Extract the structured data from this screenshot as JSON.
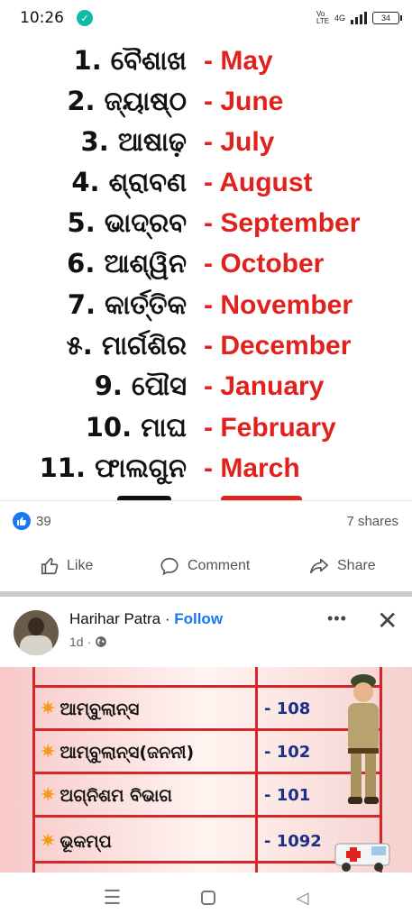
{
  "status_bar": {
    "time": "10:26",
    "network_label": "Vo LTE",
    "network_type": "4G",
    "battery": "34"
  },
  "post1": {
    "image": {
      "months": [
        {
          "odia": "1. ବୈଶାଖ",
          "english": "- May"
        },
        {
          "odia": "2. ଜ୍ୟାଷ୍ଠ",
          "english": "- June"
        },
        {
          "odia": "3. ଆଷାଢ଼",
          "english": "- July"
        },
        {
          "odia": "4. ଶ୍ରାବଣ",
          "english": "- August"
        },
        {
          "odia": "5. ଭାଦ୍ରବ",
          "english": "- September"
        },
        {
          "odia": "6. ଆଶ୍ୱିନ",
          "english": "- October"
        },
        {
          "odia": "7. କାର୍ତ୍ତିକ",
          "english": "- November"
        },
        {
          "odia": "୫. ମାର୍ଗଶିର",
          "english": "- December"
        },
        {
          "odia": "9. ପୌସ",
          "english": "- January"
        },
        {
          "odia": "10. ମାଘ",
          "english": "- February"
        },
        {
          "odia": "11. ଫାଲଗୁନ",
          "english": "- March"
        }
      ]
    },
    "reactions": {
      "count": "39",
      "icon": "like-icon",
      "color": "#1877f2"
    },
    "shares": "7 shares",
    "actions": {
      "like": "Like",
      "comment": "Comment",
      "share": "Share"
    }
  },
  "post2": {
    "author": "Harihar Patra",
    "separator": " · ",
    "follow": "Follow",
    "time": "1d",
    "dot": "·",
    "image": {
      "rows": [
        {
          "name": "ଆମ୍ବୁଲାନ୍ସ",
          "number": "- 108"
        },
        {
          "name": "ଆମ୍ବୁଲାନ୍ସ(ଜନନୀ)",
          "number": "- 102"
        },
        {
          "name": "ଅଗ୍ନିଶମ ବିଭାଗ",
          "number": "- 101"
        },
        {
          "name": "ଭୂକମ୍ପ",
          "number": "- 1092"
        }
      ]
    }
  },
  "colors": {
    "english_month": "#e0211c",
    "table_border": "#d7262b",
    "table_number": "#1a2f8a",
    "follow": "#1877f2"
  }
}
